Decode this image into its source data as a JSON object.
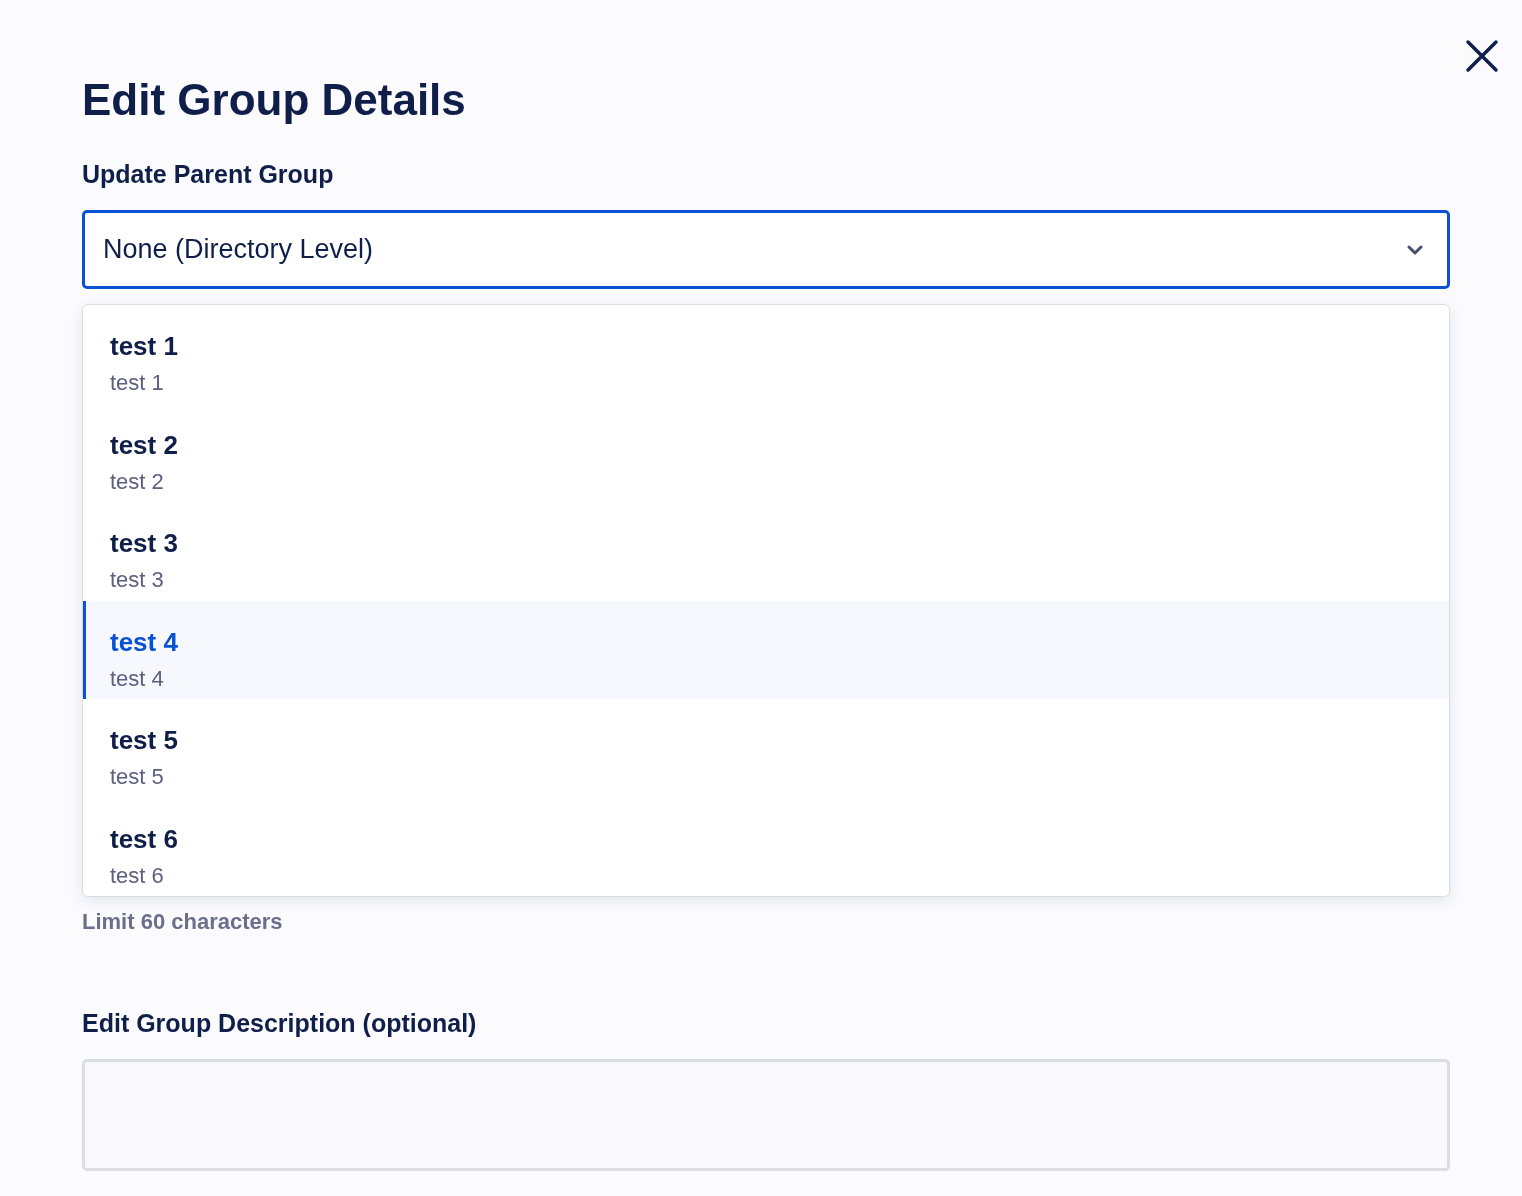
{
  "dialog": {
    "title": "Edit Group Details"
  },
  "parent_group": {
    "label": "Update Parent Group",
    "value": "None (Directory Level)",
    "expanded": true,
    "options": [
      {
        "title": "test 1",
        "subtitle": "test 1",
        "selected": false
      },
      {
        "title": "test 2",
        "subtitle": "test 2",
        "selected": false
      },
      {
        "title": "test 3",
        "subtitle": "test 3",
        "selected": false
      },
      {
        "title": "test 4",
        "subtitle": "test 4",
        "selected": true
      },
      {
        "title": "test 5",
        "subtitle": "test 5",
        "selected": false
      },
      {
        "title": "test 6",
        "subtitle": "test 6",
        "selected": false
      }
    ]
  },
  "name_hint": "Limit 60 characters",
  "description": {
    "label": "Edit Group Description (optional)"
  }
}
